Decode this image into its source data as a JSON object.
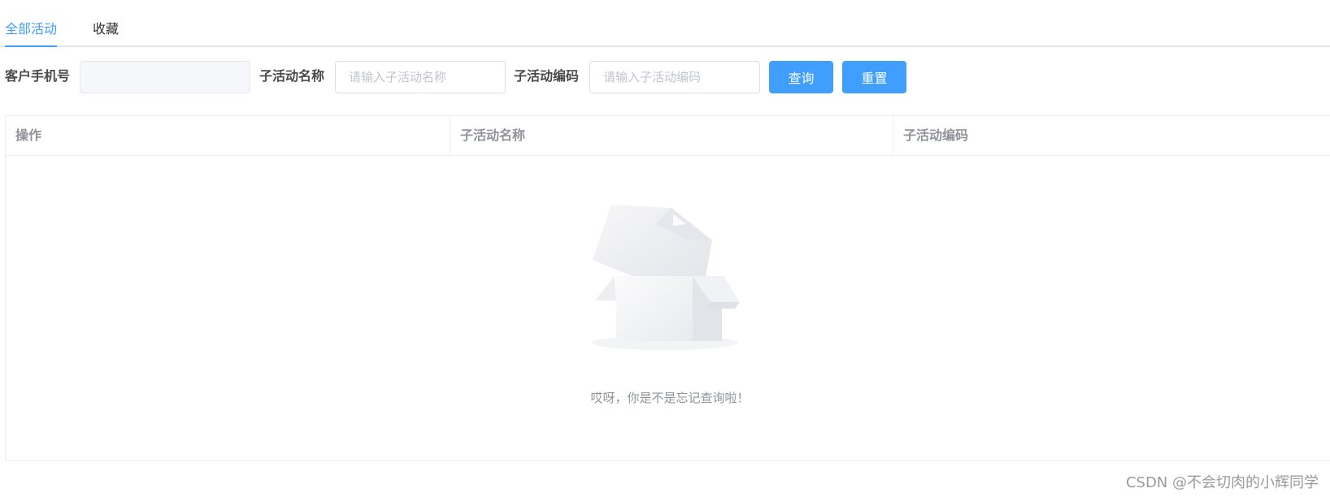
{
  "tabs": [
    {
      "label": "全部活动",
      "active": true
    },
    {
      "label": "收藏",
      "active": false
    }
  ],
  "filters": {
    "phone": {
      "label": "客户手机号",
      "value": "",
      "placeholder": "",
      "disabled": true
    },
    "sub_activity_name": {
      "label": "子活动名称",
      "value": "",
      "placeholder": "请输入子活动名称"
    },
    "sub_activity_code": {
      "label": "子活动编码",
      "value": "",
      "placeholder": "请输入子活动编码"
    }
  },
  "buttons": {
    "query": "查询",
    "reset": "重置"
  },
  "table": {
    "columns": [
      "操作",
      "子活动名称",
      "子活动编码"
    ],
    "rows": [],
    "empty_text": "哎呀，你是不是忘记查询啦！"
  },
  "watermark": "CSDN @不会切肉的小辉同学",
  "colors": {
    "accent": "#409eff",
    "border": "#ebeef5",
    "muted": "#909399"
  }
}
